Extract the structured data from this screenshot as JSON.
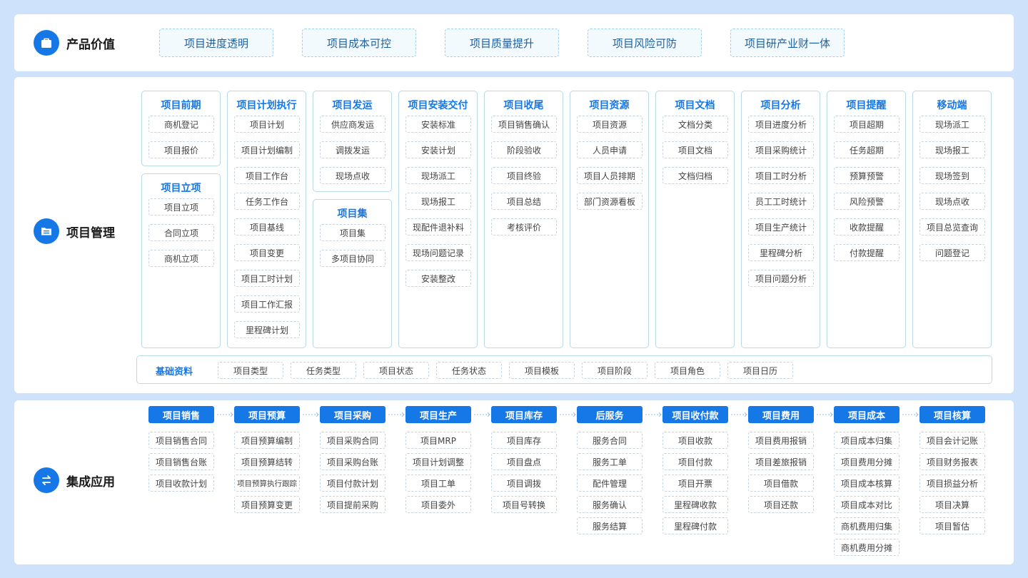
{
  "value": {
    "title": "产品价值",
    "icon": "briefcase-icon",
    "items": [
      "项目进度透明",
      "项目成本可控",
      "项目质量提升",
      "项目风险可防",
      "项目研产业财一体"
    ]
  },
  "pm": {
    "title": "项目管理",
    "icon": "folder-list-icon",
    "modules": [
      {
        "title": "项目前期",
        "items": [
          "商机登记",
          "项目报价"
        ]
      },
      {
        "title": "项目立项",
        "items": [
          "项目立项",
          "合同立项",
          "商机立项"
        ]
      },
      {
        "title": "项目计划执行",
        "items": [
          "项目计划",
          "项目计划编制",
          "项目工作台",
          "任务工作台",
          "项目基线",
          "项目变更",
          "项目工时计划",
          "项目工作汇报",
          "里程碑计划"
        ]
      },
      {
        "title": "项目发运",
        "items": [
          "供应商发运",
          "调拨发运",
          "现场点收"
        ]
      },
      {
        "title": "项目集",
        "items": [
          "项目集",
          "多项目协同"
        ]
      },
      {
        "title": "项目安装交付",
        "items": [
          "安装标准",
          "安装计划",
          "现场派工",
          "现场报工",
          "现配件退补料",
          "现场问题记录",
          "安装整改"
        ]
      },
      {
        "title": "项目收尾",
        "items": [
          "项目销售确认",
          "阶段验收",
          "项目终验",
          "项目总结",
          "考核评价"
        ]
      },
      {
        "title": "项目资源",
        "items": [
          "项目资源",
          "人员申请",
          "项目人员排期",
          "部门资源看板"
        ]
      },
      {
        "title": "项目文档",
        "items": [
          "文档分类",
          "项目文档",
          "文档归档"
        ]
      },
      {
        "title": "项目分析",
        "items": [
          "项目进度分析",
          "项目采购统计",
          "项目工时分析",
          "员工工时统计",
          "项目生产统计",
          "里程碑分析",
          "项目问题分析"
        ]
      },
      {
        "title": "项目提醒",
        "items": [
          "项目超期",
          "任务超期",
          "预算预警",
          "风险预警",
          "收款提醒",
          "付款提醒"
        ]
      },
      {
        "title": "移动端",
        "items": [
          "现场派工",
          "现场报工",
          "现场签到",
          "现场点收",
          "项目总览查询",
          "问题登记"
        ]
      }
    ],
    "base": {
      "title": "基础资料",
      "items": [
        "项目类型",
        "任务类型",
        "项目状态",
        "任务状态",
        "项目模板",
        "项目阶段",
        "项目角色",
        "项目日历"
      ]
    }
  },
  "integration": {
    "title": "集成应用",
    "icon": "swap-icon",
    "columns": [
      {
        "title": "项目销售",
        "items": [
          "项目销售合同",
          "项目销售台账",
          "项目收款计划"
        ]
      },
      {
        "title": "项目预算",
        "items": [
          "项目预算编制",
          "项目预算结转",
          "项目预算执行跟踪",
          "项目预算变更"
        ]
      },
      {
        "title": "项目采购",
        "items": [
          "项目采购合同",
          "项目采购台账",
          "项目付款计划",
          "项目提前采购"
        ]
      },
      {
        "title": "项目生产",
        "items": [
          "项目MRP",
          "项目计划调整",
          "项目工单",
          "项目委外"
        ]
      },
      {
        "title": "项目库存",
        "items": [
          "项目库存",
          "项目盘点",
          "项目调拨",
          "项目号转换"
        ]
      },
      {
        "title": "后服务",
        "items": [
          "服务合同",
          "服务工单",
          "配件管理",
          "服务确认",
          "服务结算"
        ]
      },
      {
        "title": "项目收付款",
        "items": [
          "项目收款",
          "项目付款",
          "项目开票",
          "里程碑收款",
          "里程碑付款"
        ]
      },
      {
        "title": "项目费用",
        "items": [
          "项目费用报销",
          "项目差旅报销",
          "项目借款",
          "项目还款"
        ]
      },
      {
        "title": "项目成本",
        "items": [
          "项目成本归集",
          "项目费用分摊",
          "项目成本核算",
          "项目成本对比",
          "商机费用归集",
          "商机费用分摊"
        ]
      },
      {
        "title": "项目核算",
        "items": [
          "项目会计记账",
          "项目财务报表",
          "项目损益分析",
          "项目决算",
          "项目暂估"
        ]
      }
    ]
  },
  "colors": {
    "accent": "#1677e6",
    "background": "#cfe2fb"
  }
}
